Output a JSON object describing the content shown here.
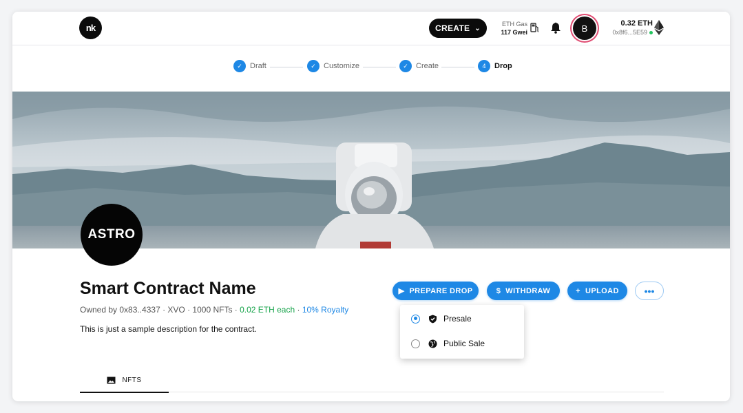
{
  "header": {
    "logo": "nk",
    "create_label": "CREATE",
    "gas_label": "ETH Gas",
    "gas_value": "117 Gwei",
    "avatar_letter": "B",
    "balance": "0.32 ETH",
    "address": "0x8f6...5E59"
  },
  "steps": [
    {
      "label": "Draft",
      "state": "done"
    },
    {
      "label": "Customize",
      "state": "done"
    },
    {
      "label": "Create",
      "state": "done"
    },
    {
      "number": "4",
      "label": "Drop",
      "state": "active"
    }
  ],
  "collection": {
    "logo_text": "ASTRO",
    "title": "Smart Contract Name",
    "owner_meta": "Owned by 0x83..4337 · XVO · 1000 NFTs · ",
    "price": "0.02 ETH each",
    "separator": " · ",
    "royalty": "10% Royalty",
    "description": "This is just a sample description for the contract."
  },
  "actions": {
    "prepare_drop": "PREPARE DROP",
    "withdraw": "WITHDRAW",
    "upload": "UPLOAD",
    "more": "•••"
  },
  "drop_menu": {
    "options": [
      {
        "label": "Presale",
        "selected": true,
        "icon": "shield-icon"
      },
      {
        "label": "Public Sale",
        "selected": false,
        "icon": "globe-icon"
      }
    ]
  },
  "tabs": [
    {
      "label": "NFTS",
      "icon": "image-icon",
      "active": true
    }
  ],
  "colors": {
    "accent": "#1e88e5",
    "price_green": "#16a34a",
    "avatar_ring": "#e04d73"
  }
}
